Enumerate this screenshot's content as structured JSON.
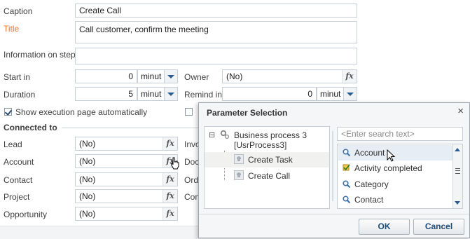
{
  "form": {
    "caption_label": "Caption",
    "caption_value": "Create Call",
    "title_label": "Title",
    "title_value": "Call customer, confirm the meeting",
    "info_label": "Information on step",
    "info_value": "",
    "start_in_label": "Start in",
    "start_in_value": "0",
    "start_in_unit": "minut",
    "duration_label": "Duration",
    "duration_value": "5",
    "duration_unit": "minut",
    "owner_label": "Owner",
    "owner_value": "(No)",
    "remind_label": "Remind in",
    "remind_value": "0",
    "remind_unit": "minut",
    "show_page_label": "Show execution page automatically",
    "show_page_checked": true,
    "connected_title": "Connected to",
    "lead_label": "Lead",
    "lead_value": "(No)",
    "account_label": "Account",
    "account_value": "(No)",
    "contact_label": "Contact",
    "contact_value": "(No)",
    "project_label": "Project",
    "project_value": "(No)",
    "opportunity_label": "Opportunity",
    "opportunity_value": "(No)",
    "invo_label": "Invo",
    "docu_label": "Docu",
    "orde_label": "Orde",
    "cont_label": "Cont",
    "fx_label": "fx"
  },
  "dialog": {
    "title": "Parameter Selection",
    "close": "×",
    "tree": {
      "toggle": "⊟",
      "root_line1": "Business process 3",
      "root_line2": "[UsrProcess3]",
      "children": [
        "Create Task",
        "Create Call"
      ]
    },
    "search_placeholder": "<Enter search text>",
    "items": [
      "Account",
      "Activity completed",
      "Category",
      "Contact"
    ],
    "ok": "OK",
    "cancel": "Cancel"
  },
  "colors": {
    "required_label": "#e7742b",
    "accent": "#2a5e92",
    "highlight": "#e6edf5"
  }
}
